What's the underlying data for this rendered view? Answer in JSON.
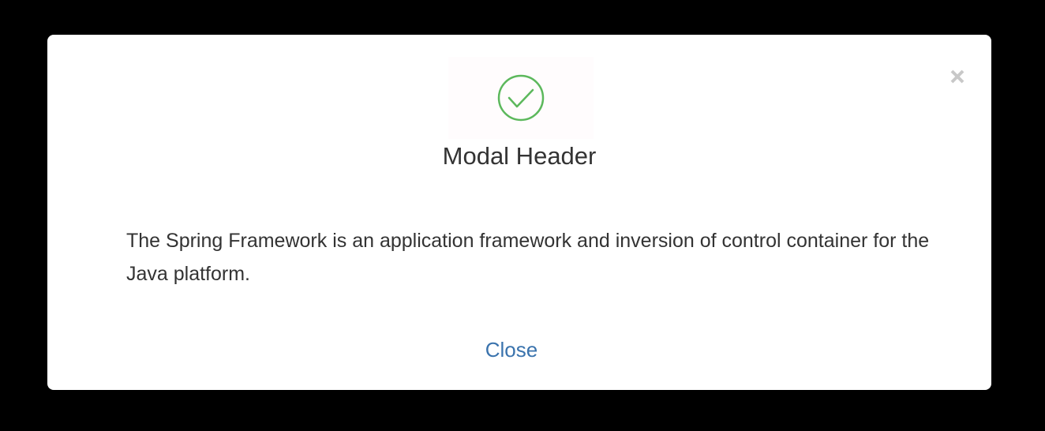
{
  "modal": {
    "title": "Modal Header",
    "body": "The Spring Framework is an application framework and inversion of control container for the Java platform.",
    "close_link_label": "Close",
    "status_icon": "check-circle-icon",
    "dismiss_icon": "close-icon"
  },
  "colors": {
    "backdrop": "#000000",
    "modal_bg": "#ffffff",
    "success_green": "#5cb85c",
    "link_blue": "#3a73ad",
    "close_x_gray": "#c8c8c8",
    "text": "#333333"
  }
}
